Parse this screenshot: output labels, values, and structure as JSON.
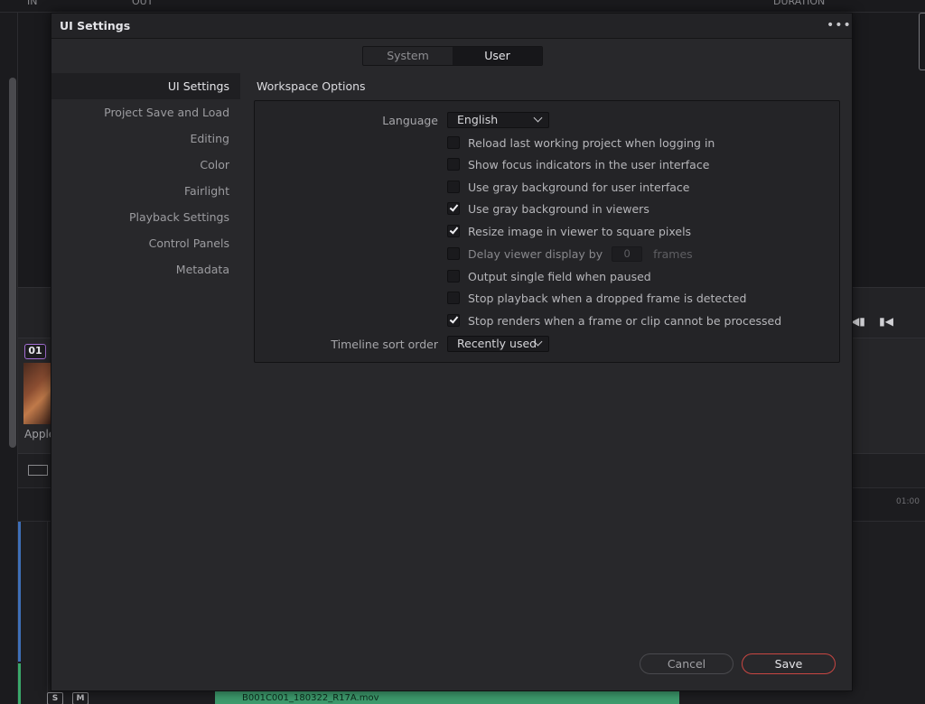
{
  "background": {
    "top_in": "IN",
    "top_out": "OUT",
    "top_duration": "DURATION",
    "clip_badge": "01",
    "clip_label": "Apple",
    "track_solo": "S",
    "track_mute": "M",
    "audio_clip_name": "B001C001_180322_R17A.mov"
  },
  "dialog": {
    "title": "UI Settings",
    "more_label": "•••",
    "scope_tabs": [
      {
        "label": "System"
      },
      {
        "label": "User"
      }
    ],
    "active_scope": "User",
    "nav": [
      {
        "label": "UI Settings"
      },
      {
        "label": "Project Save and Load"
      },
      {
        "label": "Editing"
      },
      {
        "label": "Color"
      },
      {
        "label": "Fairlight"
      },
      {
        "label": "Playback Settings"
      },
      {
        "label": "Control Panels"
      },
      {
        "label": "Metadata"
      }
    ],
    "active_nav": "UI Settings",
    "section_title": "Workspace Options",
    "language": {
      "label": "Language",
      "value": "English"
    },
    "options": [
      {
        "label": "Reload last working project when logging in",
        "checked": false
      },
      {
        "label": "Show focus indicators in the user interface",
        "checked": false
      },
      {
        "label": "Use gray background for user interface",
        "checked": false
      },
      {
        "label": "Use gray background in viewers",
        "checked": true
      },
      {
        "label": "Resize image in viewer to square pixels",
        "checked": true
      },
      {
        "label": "Delay viewer display by",
        "checked": false,
        "value": "0",
        "unit": "frames"
      },
      {
        "label": "Output single field when paused",
        "checked": false
      },
      {
        "label": "Stop playback when a dropped frame is detected",
        "checked": false
      },
      {
        "label": "Stop renders when a frame or clip cannot be processed",
        "checked": true
      }
    ],
    "timeline_sort": {
      "label": "Timeline sort order",
      "value": "Recently used"
    },
    "buttons": {
      "cancel": "Cancel",
      "save": "Save"
    }
  },
  "colors": {
    "accent_save_border": "#c84642",
    "clip_badge_border": "#a56fd6",
    "video_track": "#3e6fb8",
    "audio_clip": "#3e9c6e"
  }
}
